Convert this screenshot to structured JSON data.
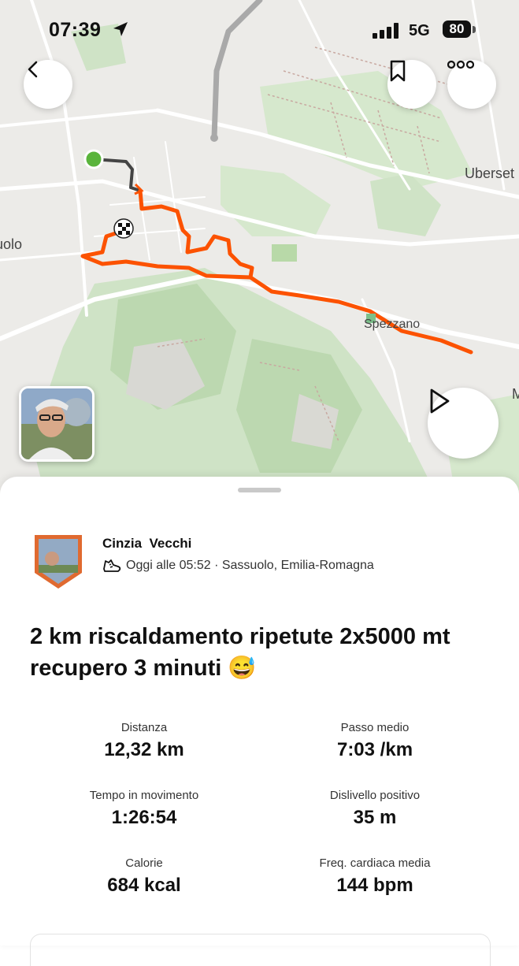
{
  "status_bar": {
    "time": "07:39",
    "network": "5G",
    "battery": "80"
  },
  "map": {
    "labels": {
      "left_town": "uolo",
      "right_town": "Uberset",
      "village": "Spezzano",
      "edge_letter": "M"
    },
    "route_color": "#fc5200",
    "start_color": "#5ab43c"
  },
  "activity": {
    "athlete_name": "Cinzia  Vecchi",
    "meta": "Oggi alle 05:52 · Sassuolo, Emilia-Romagna",
    "title": "2 km riscaldamento ripetute 2x5000 mt recupero 3 minuti 😅",
    "stats": [
      {
        "label": "Distanza",
        "value": "12,32 km"
      },
      {
        "label": "Passo medio",
        "value": "7:03 /km"
      },
      {
        "label": "Tempo in movimento",
        "value": "1:26:54"
      },
      {
        "label": "Dislivello positivo",
        "value": "35 m"
      },
      {
        "label": "Calorie",
        "value": "684 kcal"
      },
      {
        "label": "Freq. cardiaca media",
        "value": "144 bpm"
      }
    ]
  }
}
